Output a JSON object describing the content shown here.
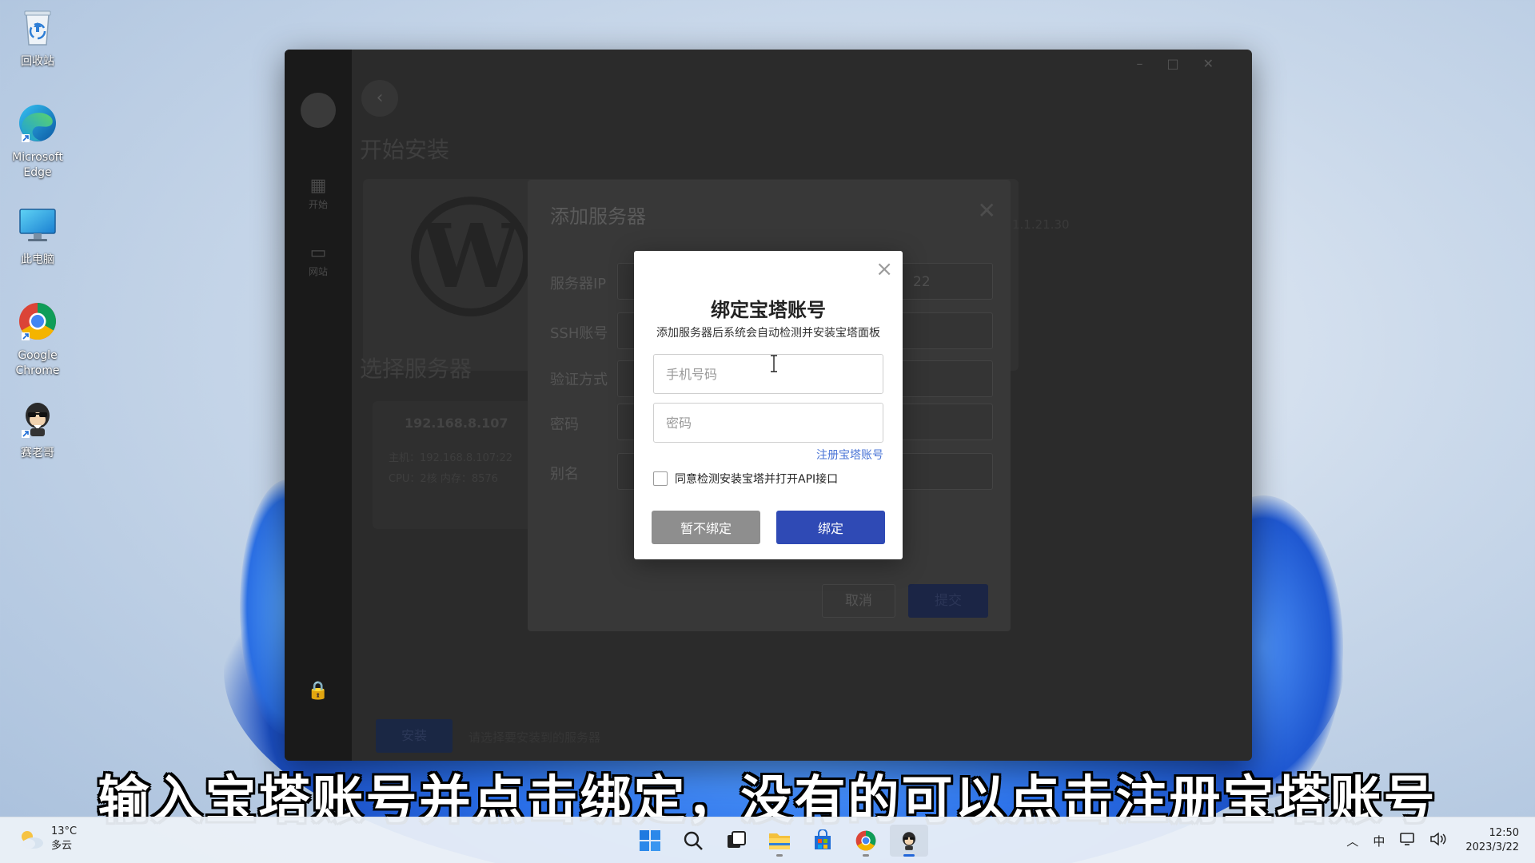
{
  "desktop": {
    "icons": [
      {
        "label": "回收站",
        "icon": "recycle-bin-icon"
      },
      {
        "label": "Microsoft Edge",
        "icon": "edge-icon"
      },
      {
        "label": "此电脑",
        "icon": "this-pc-icon"
      },
      {
        "label": "Google Chrome",
        "icon": "chrome-icon"
      },
      {
        "label": "赛老哥",
        "icon": "app-mascot-icon"
      }
    ]
  },
  "app": {
    "sidebar": [
      {
        "label": "开始",
        "icon": "grid-icon"
      },
      {
        "label": "网站",
        "icon": "site-icon"
      }
    ],
    "page_title": "开始安装",
    "section_title": "选择服务器",
    "server": {
      "ip": "192.168.8.107",
      "host_line": "主机：192.168.8.107:22",
      "cpu_line": "CPU：2核    内存：8576"
    },
    "card_ghost": "1.1.21.30",
    "install_label": "安装",
    "install_hint": "请选择要安装到的服务器"
  },
  "server_dialog": {
    "title": "添加服务器",
    "fields": [
      {
        "label": "服务器IP"
      },
      {
        "label": "SSH账号"
      },
      {
        "label": "验证方式"
      },
      {
        "label": "密码"
      },
      {
        "label": "别名"
      }
    ],
    "port_value": "22",
    "cancel_label": "取消",
    "submit_label": "提交"
  },
  "bind_dialog": {
    "title": "绑定宝塔账号",
    "subtitle": "添加服务器后系统会自动检测并安装宝塔面板",
    "phone_placeholder": "手机号码",
    "password_placeholder": "密码",
    "register_link": "注册宝塔账号",
    "agree_text": "同意检测安装宝塔并打开API接口",
    "agree_checked": false,
    "skip_label": "暂不绑定",
    "bind_label": "绑定",
    "accent": "#2f4ab5",
    "link_color": "#4a74d6"
  },
  "caption": "输入宝塔账号并点击绑定，没有的可以点击注册宝塔账号",
  "taskbar": {
    "weather": {
      "temp": "13°C",
      "desc": "多云"
    },
    "apps": [
      "windows-start-icon",
      "search-icon",
      "task-view-icon",
      "file-explorer-icon",
      "store-icon",
      "chrome-icon",
      "app-mascot-icon"
    ],
    "tray": {
      "ime": "中",
      "time": "12:50",
      "date": "2023/3/22"
    }
  }
}
